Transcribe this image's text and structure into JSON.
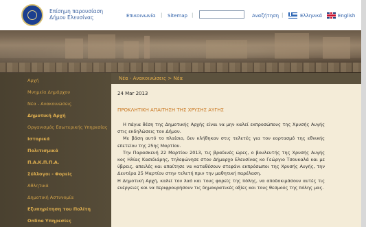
{
  "header": {
    "site_name_line1": "Επίσημη παρουσίαση",
    "site_name_line2": "Δήμου Ελευσίνας",
    "nav": {
      "contact": "Επικοινωνία",
      "sitemap": "Sitemap",
      "search_button": "Αναζήτηση",
      "search_value": "",
      "lang_gr": "Ελληνικά",
      "lang_en": "English"
    }
  },
  "sidebar": {
    "items": [
      {
        "label": "Αρχή",
        "bold": false
      },
      {
        "label": "Μνημεία Δημάρχου",
        "bold": false
      },
      {
        "label": "Νέα - Ανακοινώσεις",
        "bold": false
      },
      {
        "label": "Δημοτική Αρχή",
        "bold": true
      },
      {
        "label": "Οργανισμός Εσωτερικής Υπηρεσίας",
        "bold": false
      },
      {
        "label": "Ιστορικά",
        "bold": true
      },
      {
        "label": "Πολιτισμικά",
        "bold": true
      },
      {
        "label": "Π.Α.Κ.Π.Π.Α.",
        "bold": true
      },
      {
        "label": "Σύλλογοι - Φορείς",
        "bold": true
      },
      {
        "label": "Αθλητικά",
        "bold": false
      },
      {
        "label": "Δημοτική Αστυνομία",
        "bold": false
      },
      {
        "label": "Εξυπηρέτηση του Πολίτη",
        "bold": true
      },
      {
        "label": "Online Υπηρεσίες",
        "bold": true
      }
    ]
  },
  "content": {
    "breadcrumb": "Νέα - Ανακοινώσεις > Νέα",
    "date": "24 Mar 2013",
    "title": "ΠΡΟΚΛΗΤΙΚΗ ΑΠΑΙΤΗΣΗ ΤΗΣ ΧΡΥΣΗΣ ΑΥΓΗΣ",
    "paragraphs": [
      "Η πάγια θέση της Δημοτικής Αρχής είναι να μην καλεί εκπροσώπους της Χρυσής Αυγής στις εκδηλώσεις του Δήμου.",
      "Με βάση αυτό το πλαίσιο, δεν κλήθηκαν στις τελετές για τον εορτασμό της εθνικής επετείου της 25ης Μαρτίου.",
      "Την Παρασκευή 22 Μαρτίου 2013, τις βραδινές ώρες, ο βουλευτής της Χρυσής Αυγής κος Ηλίας Κασιδιάρης, τηλεφώνησε στον Δήμαρχο Ελευσίνας κο Γεώργιο Τσουκαλά και με ύβρεις, απειλές και απαίτησε να καταθέσουν στεφάνι εκπρόσωποι της Χρυσής Αυγής, την Δευτέρα 25 Μαρτίου στην τελετή πριν την μαθητική παρέλαση.",
      "Η Δημοτική Αρχή, καλεί τον λαό και τους φορείς της πόλης, να αποδοκιμάσουν αυτές τις ενέργειες και να περιφρουρήσουν τις δημοκρατικές αξίες και τους θεσμούς της πόλης μας."
    ]
  }
}
